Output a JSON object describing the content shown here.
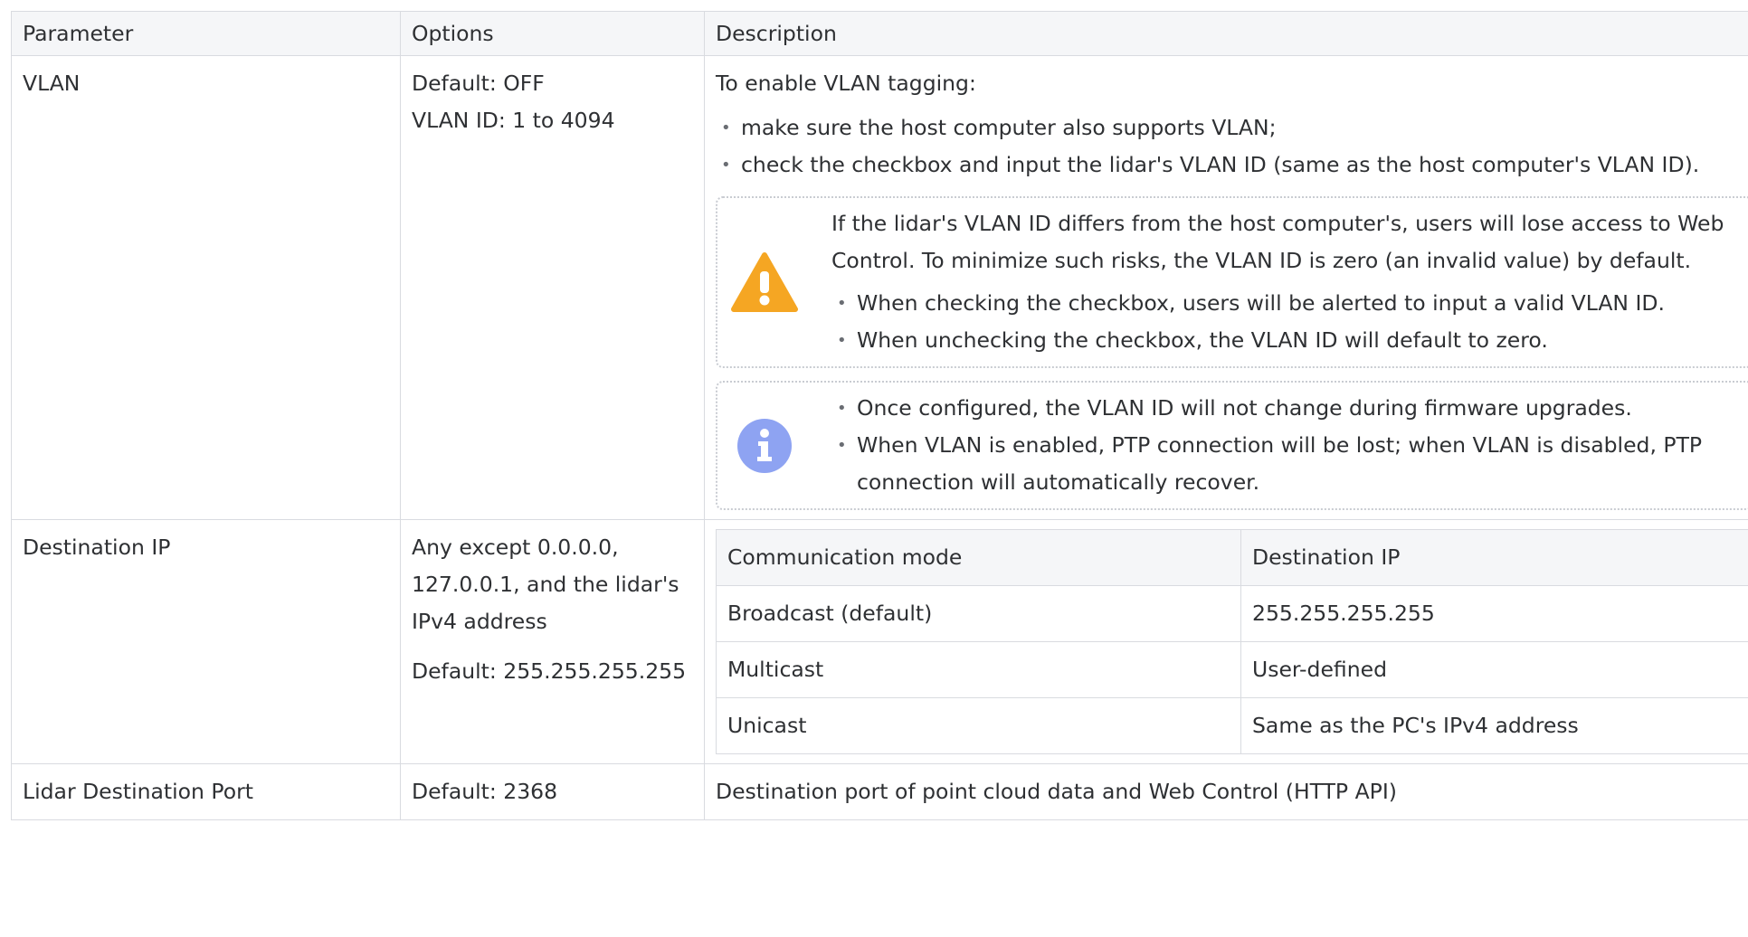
{
  "table": {
    "headers": {
      "parameter": "Parameter",
      "options": "Options",
      "description": "Description"
    },
    "rows": {
      "vlan": {
        "parameter": "VLAN",
        "options": [
          "Default: OFF",
          "VLAN ID: 1 to 4094"
        ],
        "intro": "To enable VLAN tagging:",
        "bullets": [
          "make sure the host computer also supports VLAN;",
          "check the checkbox and input the lidar's VLAN ID (same as the host computer's VLAN ID)."
        ],
        "warning": {
          "icon": "warning-icon",
          "color": "#f5a623",
          "text": "If the lidar's VLAN ID differs from the host computer's, users will lose access to Web Control. To minimize such risks, the VLAN ID is zero (an invalid value) by default.",
          "bullets": [
            "When checking the checkbox, users will be alerted to input a valid VLAN ID.",
            "When unchecking the checkbox, the VLAN ID will default to zero."
          ]
        },
        "info": {
          "icon": "info-icon",
          "color": "#8ea3f2",
          "bullets": [
            "Once configured, the VLAN ID will not change during firmware upgrades.",
            "When VLAN is enabled, PTP connection will be lost; when VLAN is disabled, PTP connection will automatically recover."
          ]
        }
      },
      "destination_ip": {
        "parameter": "Destination IP",
        "options_para1": "Any except 0.0.0.0, 127.0.0.1, and the lidar's IPv4 address",
        "options_para2": "Default: 255.255.255.255",
        "inner_table": {
          "headers": [
            "Communication mode",
            "Destination IP"
          ],
          "rows": [
            [
              "Broadcast (default)",
              "255.255.255.255"
            ],
            [
              "Multicast",
              "User-defined"
            ],
            [
              "Unicast",
              "Same as the PC's IPv4 address"
            ]
          ]
        }
      },
      "lidar_destination_port": {
        "parameter": "Lidar Destination Port",
        "options": "Default: 2368",
        "description": "Destination port of point cloud data and Web Control (HTTP API)"
      }
    }
  },
  "colors": {
    "border": "#d9dbe0",
    "header_bg": "#f5f6f8",
    "text": "#2e3033"
  }
}
